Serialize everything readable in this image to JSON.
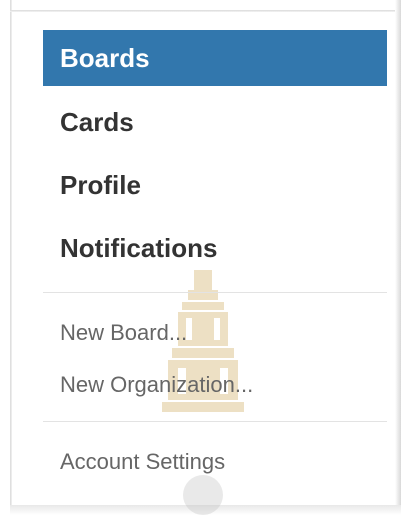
{
  "menu": {
    "primary": [
      {
        "label": "Boards",
        "active": true
      },
      {
        "label": "Cards",
        "active": false
      },
      {
        "label": "Profile",
        "active": false
      },
      {
        "label": "Notifications",
        "active": false
      }
    ],
    "secondary": [
      {
        "label": "New Board..."
      },
      {
        "label": "New Organization..."
      }
    ],
    "tertiary": [
      {
        "label": "Account Settings"
      }
    ]
  },
  "colors": {
    "active_bg": "#3277ad",
    "active_text": "#ffffff",
    "primary_text": "#333333",
    "secondary_text": "#666666",
    "divider": "#e3e3e3",
    "watermark": "#c8a14a"
  }
}
